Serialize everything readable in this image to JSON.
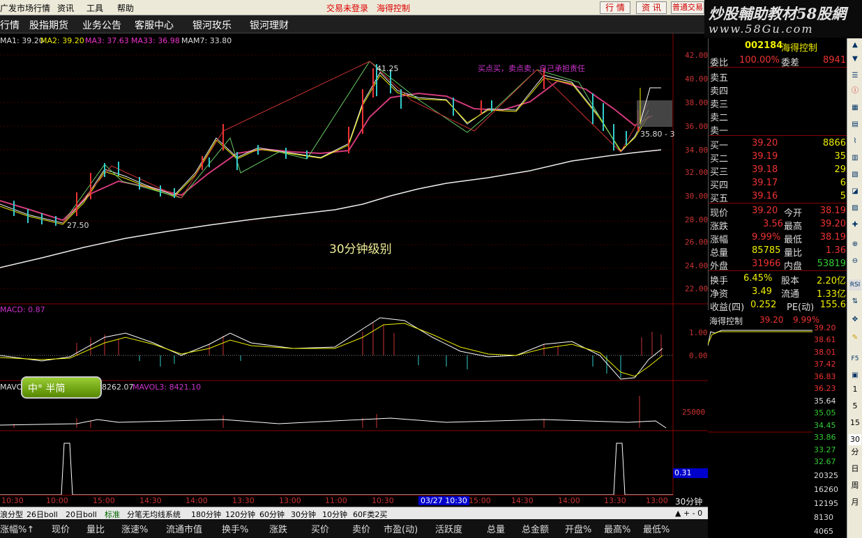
{
  "menu": {
    "items": [
      "广发市场行情",
      "资讯",
      "工具",
      "帮助"
    ],
    "center": [
      "交易未登录",
      "海得控制"
    ],
    "buttons": [
      "行 情",
      "资 讯",
      "普通交易"
    ]
  },
  "nav": {
    "items": [
      "行情",
      "股指期货",
      "业务公告",
      "客服中心",
      "银河玫乐",
      "银河理财"
    ]
  },
  "watermark": {
    "line1": "炒股輔助教材58股網",
    "line2": "www.58Gu.com"
  },
  "ma": {
    "ma1": "MA1: 39.20",
    "ma2": "MA2: 39.20",
    "ma3": "MA3: 37.63",
    "ma33": "MA33: 36.98",
    "mam7": "MAM7: 33.80"
  },
  "chart": {
    "annotation": "买点买，卖点卖，自己承担责任",
    "center_label": "30分钟级别",
    "high_label": "41.25",
    "low_label": "27.50",
    "last_label": "35.80 - 3"
  },
  "price_axis": [
    "42.00",
    "40.00",
    "38.00",
    "36.00",
    "34.00",
    "32.00",
    "30.00",
    "28.00",
    "26.00",
    "24.00",
    "22.00"
  ],
  "macd": {
    "label": "MACD: 0.87",
    "axis": [
      "1.00",
      "0.00"
    ]
  },
  "vol": {
    "label1": "MAVOL",
    "label2": "8262.07",
    "label3": "MAVOL3: 8421.10",
    "axis": "25000"
  },
  "time_axis": [
    "10:30",
    "10:00",
    "15:00",
    "14:30",
    "14:00",
    "13:30",
    "13:00",
    "11:00",
    "10:30",
    "03/27 10:30",
    "15:00",
    "14:30",
    "14:00",
    "13:30",
    "13:00"
  ],
  "bottom_indicator": {
    "value": "0.31"
  },
  "period_label": "30分钟",
  "periods": [
    "浪分型",
    "26日boll",
    "20日boll",
    "标准",
    "分笔无均线系统",
    "180分钟",
    "120分钟",
    "60分钟",
    "30分钟",
    "10分钟",
    "60F类2买"
  ],
  "columns": [
    "涨幅%↑",
    "现价",
    "量比",
    "涨速%",
    "流通市值",
    "换手%",
    "涨跌",
    "买价",
    "卖价",
    "市盈(动)",
    "活跃度",
    "总量",
    "总金额",
    "开盘%",
    "最高%",
    "最低%"
  ],
  "quote": {
    "code": "002184",
    "name": "海得控制",
    "weibi_lbl": "委比",
    "weibi": "100.00%",
    "weicha_lbl": "委差",
    "weicha": "8941",
    "sells": [
      "卖五",
      "卖四",
      "卖三",
      "卖二",
      "卖一"
    ],
    "buys": [
      {
        "l": "买一",
        "p": "39.20",
        "v": "8866"
      },
      {
        "l": "买二",
        "p": "39.19",
        "v": "35"
      },
      {
        "l": "买三",
        "p": "39.18",
        "v": "29"
      },
      {
        "l": "买四",
        "p": "39.17",
        "v": "6"
      },
      {
        "l": "买五",
        "p": "39.16",
        "v": "5"
      }
    ],
    "stats": [
      {
        "a": "现价",
        "av": "39.20",
        "b": "今开",
        "bv": "38.19"
      },
      {
        "a": "涨跌",
        "av": "3.56",
        "b": "最高",
        "bv": "39.20"
      },
      {
        "a": "涨幅",
        "av": "9.99%",
        "b": "最低",
        "bv": "38.19"
      },
      {
        "a": "总量",
        "av": "85785",
        "b": "量比",
        "bv": "1.36"
      },
      {
        "a": "外盘",
        "av": "31966",
        "b": "内盘",
        "bv": "53819"
      },
      {
        "a": "换手",
        "av": "6.45%",
        "b": "股本",
        "bv": "2.20亿"
      },
      {
        "a": "净资",
        "av": "3.49",
        "b": "流通",
        "bv": "1.33亿"
      },
      {
        "a": "收益(四)",
        "av": "0.252",
        "b": "PE(动)",
        "bv": "155.6"
      }
    ]
  },
  "mini": {
    "name": "海得控制",
    "price": "39.20",
    "pct": "9.99%",
    "axis": [
      "39.20",
      "38.61",
      "38.01",
      "37.42",
      "36.83",
      "36.23",
      "35.64",
      "35.05",
      "34.45",
      "33.86",
      "33.27",
      "32.67",
      "20325",
      "16260",
      "12195",
      "8130",
      "4065"
    ]
  },
  "sidebar": [
    "1",
    "5",
    "15",
    "30",
    "分",
    "日",
    "周",
    "月"
  ],
  "ime": "中° 半简"
}
